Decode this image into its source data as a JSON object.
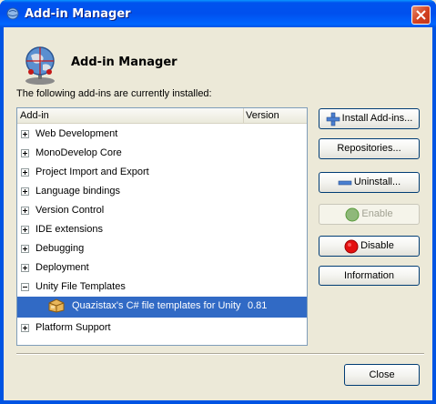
{
  "window": {
    "title": "Add-in Manager"
  },
  "header": {
    "title": "Add-in Manager",
    "icon": "globe-network-icon"
  },
  "intro_text": "The following add-ins are currently installed:",
  "table": {
    "columns": [
      "Add-in",
      "Version"
    ],
    "rows": [
      {
        "label": "Web Development",
        "expanded": false
      },
      {
        "label": "MonoDevelop Core",
        "expanded": false
      },
      {
        "label": "Project Import and Export",
        "expanded": false
      },
      {
        "label": "Language bindings",
        "expanded": false
      },
      {
        "label": "Version Control",
        "expanded": false
      },
      {
        "label": "IDE extensions",
        "expanded": false
      },
      {
        "label": "Debugging",
        "expanded": false
      },
      {
        "label": "Deployment",
        "expanded": false
      },
      {
        "label": "Unity File Templates",
        "expanded": true
      },
      {
        "label": "Quazistax's C# file templates for Unity",
        "version": "0.81",
        "selected": true,
        "icon": "package-icon"
      },
      {
        "label": "Platform Support",
        "expanded": false
      }
    ]
  },
  "buttons": {
    "install": {
      "label": "Install Add-ins...",
      "icon": "plus-icon",
      "accent": "#4a7fd1"
    },
    "repositories": {
      "label": "Repositories..."
    },
    "uninstall": {
      "label": "Uninstall...",
      "icon": "minus-icon",
      "accent": "#4a7fd1"
    },
    "enable": {
      "label": "Enable",
      "icon": "green-circle-icon",
      "accent": "#5a9c3b",
      "disabled": true
    },
    "disable": {
      "label": "Disable",
      "icon": "red-circle-icon",
      "accent": "#d40000"
    },
    "information": {
      "label": "Information"
    },
    "close": {
      "label": "Close"
    }
  },
  "colors": {
    "selection": "#316ac5",
    "titlebar": "#0054e3"
  }
}
